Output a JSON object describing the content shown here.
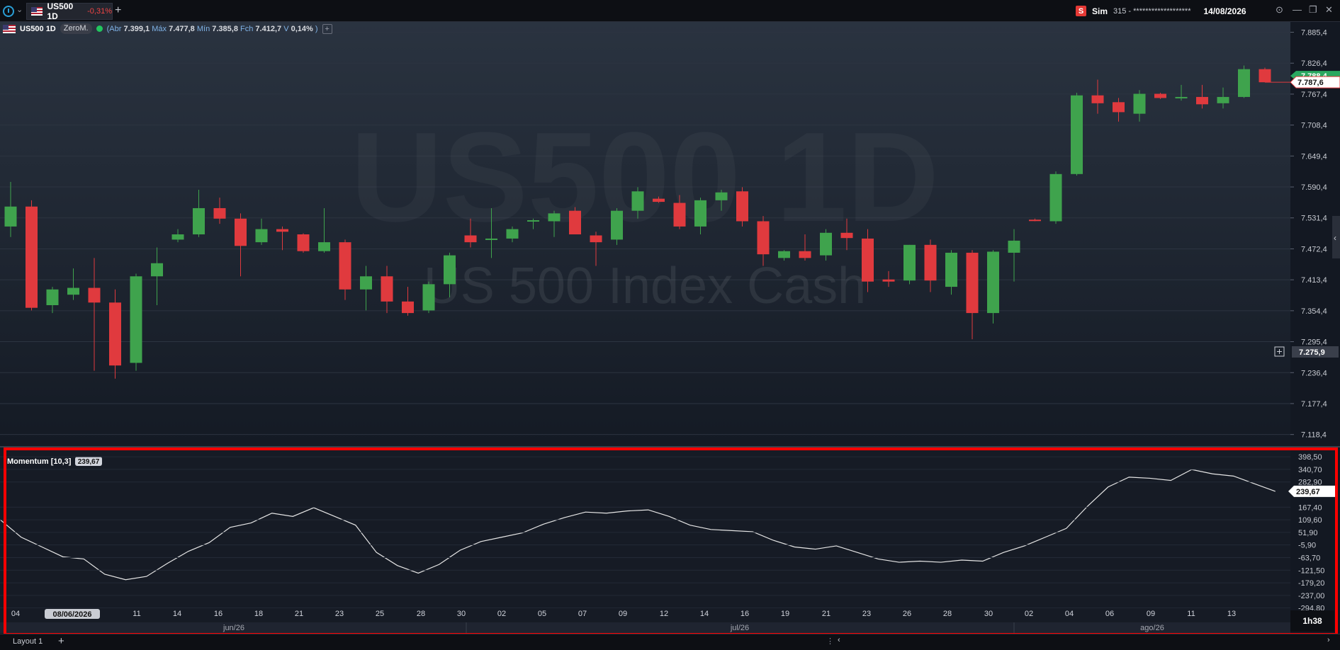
{
  "tab": {
    "symbol": "US500 1D",
    "change": "-0,31%",
    "add": "+"
  },
  "account": {
    "logo": "S",
    "name": "Sim",
    "id": "315 - *******************",
    "date": "14/08/2026"
  },
  "window_controls": {
    "settings_icon": "gear-circle-icon",
    "minimize": "—",
    "restore": "❐",
    "close": "✕"
  },
  "legend": {
    "symbol": "US500 1D",
    "broker": "ZeroM.",
    "open_label": "Abr",
    "open": "7.399,1",
    "high_label": "Máx",
    "high": "7.477,8",
    "low_label": "Mín",
    "low": "7.385,8",
    "close_label": "Fch",
    "close": "7.412,7",
    "volume_label": "V",
    "change": "0,14%"
  },
  "watermark": {
    "line1": "US500 1D",
    "line2": "US 500 Index Cash"
  },
  "price_axis": {
    "ticks": [
      "7.885,4",
      "7.826,4",
      "7.767,4",
      "7.708,4",
      "7.649,4",
      "7.590,4",
      "7.531,4",
      "7.472,4",
      "7.413,4",
      "7.354,4",
      "7.295,4",
      "7.236,4",
      "7.177,4",
      "7.118,4"
    ],
    "last_price": "7.787,6",
    "bid_price": "7.788,4",
    "crosshair_price": "7.275,9"
  },
  "indicator": {
    "name": "Momentum [10,3]",
    "value": "239,67",
    "ticks": [
      "398,50",
      "340,70",
      "282,90",
      "167,40",
      "109,60",
      "51,90",
      "-5,90",
      "-63,70",
      "-121,50",
      "-179,20",
      "-237,00",
      "-294,80"
    ]
  },
  "time_axis": {
    "day_labels": [
      "04",
      "11",
      "14",
      "16",
      "18",
      "21",
      "23",
      "25",
      "28",
      "30",
      "02",
      "05",
      "07",
      "09",
      "12",
      "14",
      "16",
      "19",
      "21",
      "23",
      "26",
      "28",
      "30",
      "02",
      "04",
      "06",
      "09",
      "11",
      "13"
    ],
    "highlight": "08/06/2026",
    "months": [
      "jun/26",
      "jul/26",
      "ago/26"
    ],
    "timer": "1h38"
  },
  "bottom_bar": {
    "layout": "Layout 1",
    "add": "+"
  },
  "colors": {
    "up": "#3fa34d",
    "down": "#e03a3e",
    "background": "#131722",
    "highlight_border": "#ff0000"
  },
  "chart_data": {
    "type": "candlestick",
    "title": "US500 1D",
    "subtitle": "US 500 Index Cash",
    "ylim": [
      7095,
      7905
    ],
    "candles": [
      {
        "o": 7515,
        "h": 7600,
        "l": 7495,
        "c": 7553
      },
      {
        "o": 7553,
        "h": 7565,
        "l": 7355,
        "c": 7360
      },
      {
        "o": 7365,
        "h": 7400,
        "l": 7350,
        "c": 7395
      },
      {
        "o": 7385,
        "h": 7435,
        "l": 7375,
        "c": 7398
      },
      {
        "o": 7398,
        "h": 7455,
        "l": 7240,
        "c": 7370
      },
      {
        "o": 7370,
        "h": 7395,
        "l": 7225,
        "c": 7250
      },
      {
        "o": 7255,
        "h": 7425,
        "l": 7240,
        "c": 7420
      },
      {
        "o": 7420,
        "h": 7475,
        "l": 7365,
        "c": 7445
      },
      {
        "o": 7490,
        "h": 7510,
        "l": 7485,
        "c": 7500
      },
      {
        "o": 7500,
        "h": 7585,
        "l": 7495,
        "c": 7550
      },
      {
        "o": 7550,
        "h": 7570,
        "l": 7520,
        "c": 7530
      },
      {
        "o": 7530,
        "h": 7540,
        "l": 7420,
        "c": 7478
      },
      {
        "o": 7485,
        "h": 7530,
        "l": 7480,
        "c": 7510
      },
      {
        "o": 7510,
        "h": 7515,
        "l": 7470,
        "c": 7505
      },
      {
        "o": 7500,
        "h": 7502,
        "l": 7465,
        "c": 7468
      },
      {
        "o": 7468,
        "h": 7550,
        "l": 7465,
        "c": 7485
      },
      {
        "o": 7485,
        "h": 7490,
        "l": 7375,
        "c": 7395
      },
      {
        "o": 7395,
        "h": 7440,
        "l": 7355,
        "c": 7420
      },
      {
        "o": 7420,
        "h": 7440,
        "l": 7350,
        "c": 7372
      },
      {
        "o": 7372,
        "h": 7400,
        "l": 7345,
        "c": 7350
      },
      {
        "o": 7355,
        "h": 7410,
        "l": 7350,
        "c": 7405
      },
      {
        "o": 7405,
        "h": 7465,
        "l": 7380,
        "c": 7460
      },
      {
        "o": 7498,
        "h": 7530,
        "l": 7475,
        "c": 7485
      },
      {
        "o": 7490,
        "h": 7550,
        "l": 7455,
        "c": 7492
      },
      {
        "o": 7492,
        "h": 7515,
        "l": 7485,
        "c": 7510
      },
      {
        "o": 7525,
        "h": 7530,
        "l": 7510,
        "c": 7527
      },
      {
        "o": 7525,
        "h": 7545,
        "l": 7495,
        "c": 7540
      },
      {
        "o": 7545,
        "h": 7552,
        "l": 7500,
        "c": 7500
      },
      {
        "o": 7498,
        "h": 7505,
        "l": 7440,
        "c": 7485
      },
      {
        "o": 7490,
        "h": 7550,
        "l": 7480,
        "c": 7545
      },
      {
        "o": 7545,
        "h": 7590,
        "l": 7530,
        "c": 7582
      },
      {
        "o": 7568,
        "h": 7572,
        "l": 7560,
        "c": 7562
      },
      {
        "o": 7560,
        "h": 7575,
        "l": 7510,
        "c": 7515
      },
      {
        "o": 7515,
        "h": 7570,
        "l": 7500,
        "c": 7565
      },
      {
        "o": 7565,
        "h": 7585,
        "l": 7545,
        "c": 7580
      },
      {
        "o": 7582,
        "h": 7590,
        "l": 7515,
        "c": 7525
      },
      {
        "o": 7525,
        "h": 7535,
        "l": 7440,
        "c": 7462
      },
      {
        "o": 7455,
        "h": 7470,
        "l": 7450,
        "c": 7468
      },
      {
        "o": 7468,
        "h": 7500,
        "l": 7450,
        "c": 7455
      },
      {
        "o": 7460,
        "h": 7510,
        "l": 7450,
        "c": 7503
      },
      {
        "o": 7503,
        "h": 7530,
        "l": 7470,
        "c": 7493
      },
      {
        "o": 7492,
        "h": 7510,
        "l": 7390,
        "c": 7410
      },
      {
        "o": 7414,
        "h": 7430,
        "l": 7400,
        "c": 7410
      },
      {
        "o": 7412,
        "h": 7480,
        "l": 7405,
        "c": 7480
      },
      {
        "o": 7480,
        "h": 7490,
        "l": 7390,
        "c": 7412
      },
      {
        "o": 7400,
        "h": 7470,
        "l": 7385,
        "c": 7465
      },
      {
        "o": 7465,
        "h": 7470,
        "l": 7300,
        "c": 7350
      },
      {
        "o": 7350,
        "h": 7470,
        "l": 7330,
        "c": 7467
      },
      {
        "o": 7465,
        "h": 7510,
        "l": 7410,
        "c": 7488
      },
      {
        "o": 7528,
        "h": 7530,
        "l": 7525,
        "c": 7526
      },
      {
        "o": 7525,
        "h": 7620,
        "l": 7520,
        "c": 7615
      },
      {
        "o": 7615,
        "h": 7770,
        "l": 7612,
        "c": 7765
      },
      {
        "o": 7765,
        "h": 7795,
        "l": 7730,
        "c": 7750
      },
      {
        "o": 7752,
        "h": 7760,
        "l": 7715,
        "c": 7733
      },
      {
        "o": 7730,
        "h": 7775,
        "l": 7715,
        "c": 7768
      },
      {
        "o": 7768,
        "h": 7770,
        "l": 7758,
        "c": 7760
      },
      {
        "o": 7760,
        "h": 7785,
        "l": 7755,
        "c": 7762
      },
      {
        "o": 7762,
        "h": 7785,
        "l": 7740,
        "c": 7748
      },
      {
        "o": 7750,
        "h": 7780,
        "l": 7740,
        "c": 7762
      },
      {
        "o": 7762,
        "h": 7822,
        "l": 7760,
        "c": 7815
      },
      {
        "o": 7815,
        "h": 7818,
        "l": 7790,
        "c": 7790
      }
    ],
    "momentum": [
      110,
      30,
      -15,
      -60,
      -70,
      -140,
      -165,
      -150,
      -90,
      -35,
      5,
      75,
      95,
      140,
      125,
      165,
      125,
      85,
      -40,
      -100,
      -135,
      -95,
      -30,
      10,
      30,
      50,
      90,
      120,
      145,
      140,
      150,
      155,
      125,
      85,
      65,
      60,
      55,
      15,
      -15,
      -25,
      -10,
      -40,
      -70,
      -85,
      -80,
      -85,
      -75,
      -80,
      -40,
      -10,
      30,
      70,
      170,
      260,
      305,
      300,
      290,
      340,
      320,
      310,
      275,
      240
    ],
    "momentum_ylim": [
      -325,
      415
    ]
  }
}
